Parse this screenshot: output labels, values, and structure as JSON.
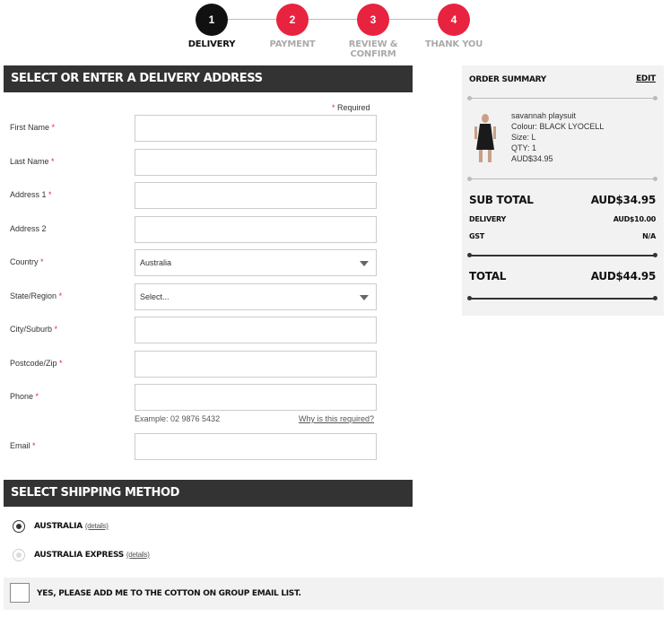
{
  "steps": [
    {
      "num": "1",
      "label": "DELIVERY",
      "active": true
    },
    {
      "num": "2",
      "label": "PAYMENT",
      "active": false
    },
    {
      "num": "3",
      "label": "REVIEW & CONFIRM",
      "active": false
    },
    {
      "num": "4",
      "label": "THANK YOU",
      "active": false
    }
  ],
  "colors": {
    "accent": "#e8233f",
    "active_step": "#111111",
    "header_bg": "#333333"
  },
  "address": {
    "title": "SELECT OR ENTER A DELIVERY ADDRESS",
    "required_note": "Required",
    "fields": [
      {
        "label": "First Name",
        "required": true,
        "type": "text",
        "value": ""
      },
      {
        "label": "Last Name",
        "required": true,
        "type": "text",
        "value": ""
      },
      {
        "label": "Address 1",
        "required": true,
        "type": "text",
        "value": ""
      },
      {
        "label": "Address 2",
        "required": false,
        "type": "text",
        "value": ""
      },
      {
        "label": "Country",
        "required": true,
        "type": "select",
        "value": "Australia"
      },
      {
        "label": "State/Region",
        "required": true,
        "type": "select",
        "value": "Select..."
      },
      {
        "label": "City/Suburb",
        "required": true,
        "type": "text",
        "value": ""
      },
      {
        "label": "Postcode/Zip",
        "required": true,
        "type": "text",
        "value": ""
      },
      {
        "label": "Phone",
        "required": true,
        "type": "text",
        "value": ""
      },
      {
        "label": "Email",
        "required": true,
        "type": "text",
        "value": ""
      }
    ],
    "phone_hint": "Example: 02 9876 5432",
    "phone_why": "Why is this required?"
  },
  "shipping": {
    "title": "SELECT SHIPPING METHOD",
    "options": [
      {
        "name": "AUSTRALIA",
        "details": "(details)",
        "selected": true
      },
      {
        "name": "AUSTRALIA EXPRESS",
        "details": "(details)",
        "selected": false
      }
    ],
    "email_optin": "YES, PLEASE ADD ME TO THE COTTON ON GROUP EMAIL LIST."
  },
  "summary": {
    "title": "ORDER SUMMARY",
    "edit": "EDIT",
    "product": {
      "name": "savannah playsuit",
      "colour": "Colour: BLACK LYOCELL",
      "size": "Size: L",
      "qty": "QTY: 1",
      "price": "AUD$34.95"
    },
    "sub_total_label": "SUB TOTAL",
    "sub_total": "AUD$34.95",
    "delivery_label": "DELIVERY",
    "delivery": "AUD$10.00",
    "gst_label": "GST",
    "gst": "N/A",
    "total_label": "TOTAL",
    "total": "AUD$44.95"
  }
}
